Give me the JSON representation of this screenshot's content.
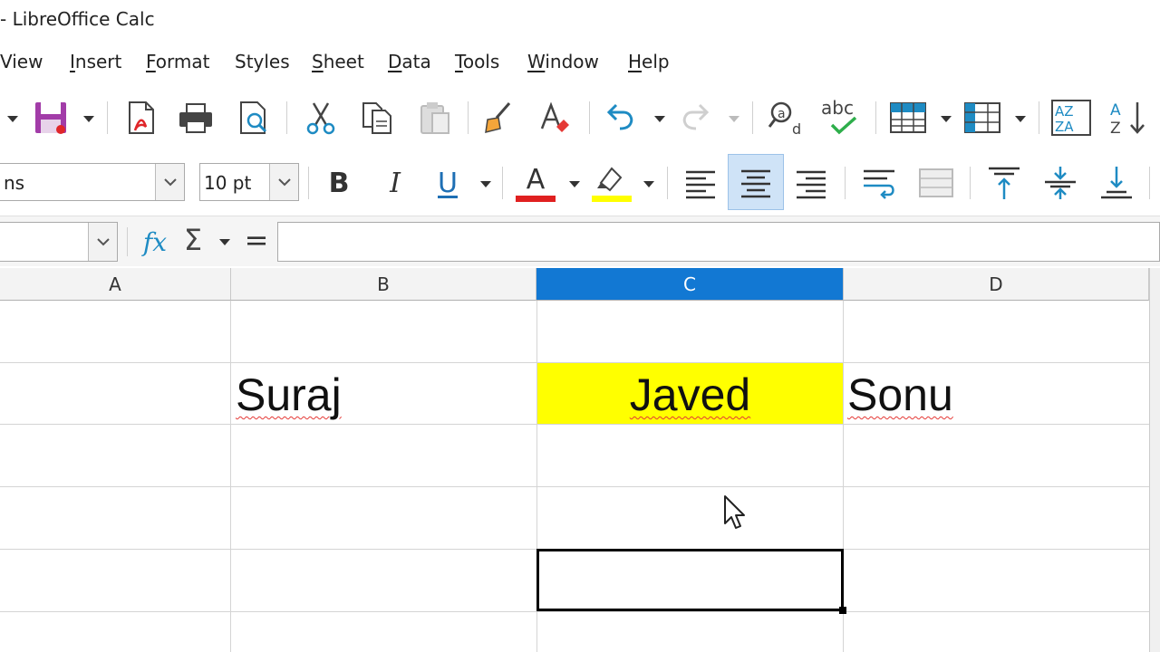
{
  "window": {
    "title": "- LibreOffice Calc"
  },
  "menu": {
    "items": [
      {
        "label": "View",
        "accel": ""
      },
      {
        "label": "Insert",
        "accel": "I"
      },
      {
        "label": "Format",
        "accel": "F"
      },
      {
        "label": "Styles",
        "accel": ""
      },
      {
        "label": "Sheet",
        "accel": "S"
      },
      {
        "label": "Data",
        "accel": "D"
      },
      {
        "label": "Tools",
        "accel": "T"
      },
      {
        "label": "Window",
        "accel": "W"
      },
      {
        "label": "Help",
        "accel": "H"
      }
    ]
  },
  "format_toolbar": {
    "font_name": "ns",
    "font_size": "10 pt",
    "bold": "B",
    "italic": "I",
    "underline": "U",
    "font_color_letter": "A",
    "font_color": "#e02020",
    "highlight_color": "#ffff00"
  },
  "standard_toolbar": {
    "spellcheck_label": "abc"
  },
  "formula_bar": {
    "name_box": "",
    "function_wizard": "fx",
    "sum": "Σ",
    "equals": "=",
    "content": ""
  },
  "sheet": {
    "columns": [
      "A",
      "B",
      "C",
      "D"
    ],
    "active_column": "C",
    "cells": {
      "B2": "Suraj",
      "C2": "Javed",
      "D2": "Sonu"
    },
    "c2_fill": "#ffff00",
    "selected_cell": "C5"
  }
}
